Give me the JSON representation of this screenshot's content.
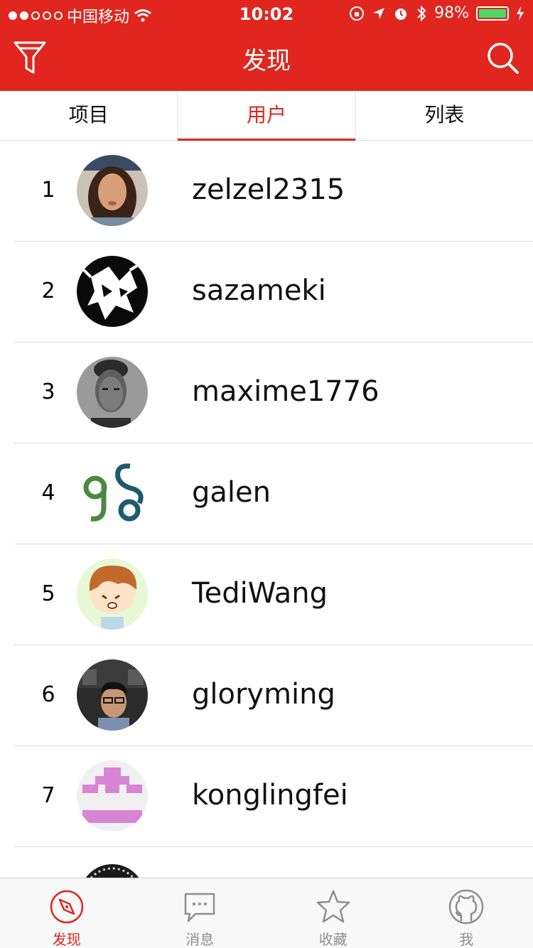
{
  "status_bar": {
    "carrier": "中国移动",
    "time": "10:02",
    "battery": "98%"
  },
  "nav": {
    "title": "发现"
  },
  "tabs": [
    {
      "label": "项目"
    },
    {
      "label": "用户"
    },
    {
      "label": "列表"
    }
  ],
  "users": [
    {
      "rank": "1",
      "name": "zelzel2315"
    },
    {
      "rank": "2",
      "name": "sazameki"
    },
    {
      "rank": "3",
      "name": "maxime1776"
    },
    {
      "rank": "4",
      "name": "galen"
    },
    {
      "rank": "5",
      "name": "TediWang"
    },
    {
      "rank": "6",
      "name": "gloryming"
    },
    {
      "rank": "7",
      "name": "konglingfei"
    }
  ],
  "tabbar": [
    {
      "label": "发现",
      "icon": "compass-icon"
    },
    {
      "label": "消息",
      "icon": "chat-icon"
    },
    {
      "label": "收藏",
      "icon": "star-icon"
    },
    {
      "label": "我",
      "icon": "github-icon"
    }
  ],
  "colors": {
    "accent": "#e0261e",
    "battery": "#4cd964"
  }
}
